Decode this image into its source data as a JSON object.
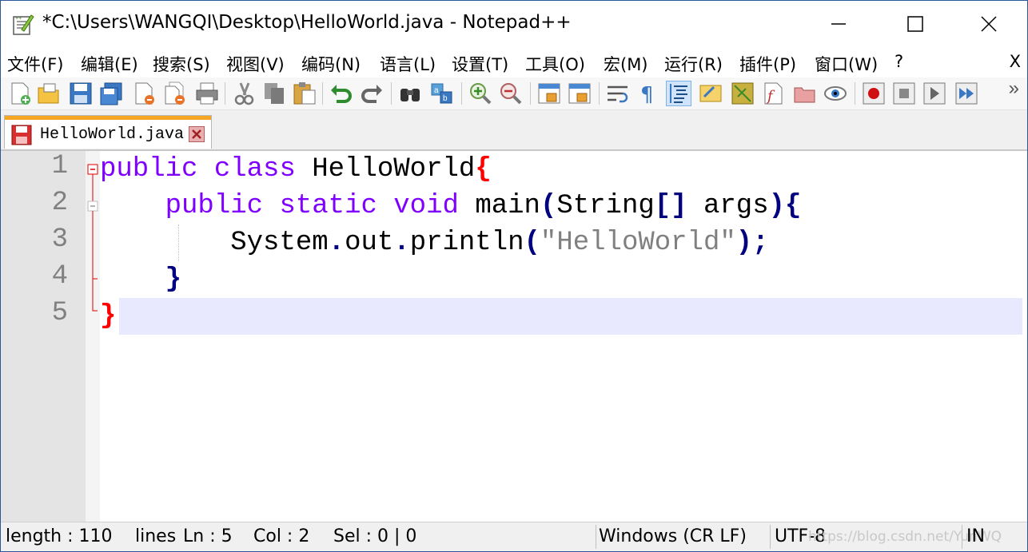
{
  "window": {
    "title": "*C:\\Users\\WANGQI\\Desktop\\HelloWorld.java - Notepad++",
    "icon": "notepadpp-icon"
  },
  "menu": {
    "items": [
      "文件(F)",
      "编辑(E)",
      "搜索(S)",
      "视图(V)",
      "编码(N)",
      "语言(L)",
      "设置(T)",
      "工具(O)",
      "宏(M)",
      "运行(R)",
      "插件(P)",
      "窗口(W)",
      "?"
    ],
    "close": "X"
  },
  "toolbar": {
    "buttons": [
      "new-file",
      "open-file",
      "save",
      "save-all",
      "close",
      "close-all",
      "print",
      "cut",
      "copy",
      "paste",
      "undo",
      "redo",
      "find",
      "replace",
      "zoom-in",
      "zoom-out",
      "sync-vertical",
      "sync-horizontal",
      "word-wrap",
      "show-all-chars",
      "indent-guide",
      "user-defined-language",
      "document-map",
      "function-list",
      "folder-as-workspace",
      "monitoring",
      "record-macro",
      "stop-recording",
      "playback-macro",
      "run-macro-multiple"
    ],
    "more": "»"
  },
  "tab": {
    "label": "HelloWorld.java"
  },
  "editor": {
    "line_numbers": [
      "1",
      "2",
      "3",
      "4",
      "5"
    ],
    "lines": [
      {
        "t1": "public",
        "t2": "class",
        "t3": "HelloWorld",
        "t4": "{"
      },
      {
        "t1": "public",
        "t2": "static",
        "t3": "void",
        "t4": "main",
        "t5": "(",
        "t6": "String",
        "t7": "[]",
        "t8": "args",
        "t9": ")",
        "t10": "{"
      },
      {
        "t1": "System",
        "t2": ".",
        "t3": "out",
        "t4": ".",
        "t5": "println",
        "t6": "(",
        "t7": "\"HelloWorld\"",
        "t8": ")",
        "t9": ";"
      },
      {
        "t1": "}"
      },
      {
        "t1": "}"
      }
    ]
  },
  "status": {
    "length": "length : 110",
    "lines": "lines",
    "ln": "Ln : 5",
    "col": "Col : 2",
    "sel": "Sel : 0 | 0",
    "eol": "Windows (CR LF)",
    "encoding": "UTF-8",
    "mode": "IN",
    "watermark": "https://blog.csdn.net/YunWQ"
  },
  "colors": {
    "keyword": "#8000ff",
    "brace_outer": "#ff0000",
    "brace_inner": "#000080",
    "string": "#808080",
    "current_line": "#e8e8ff"
  }
}
